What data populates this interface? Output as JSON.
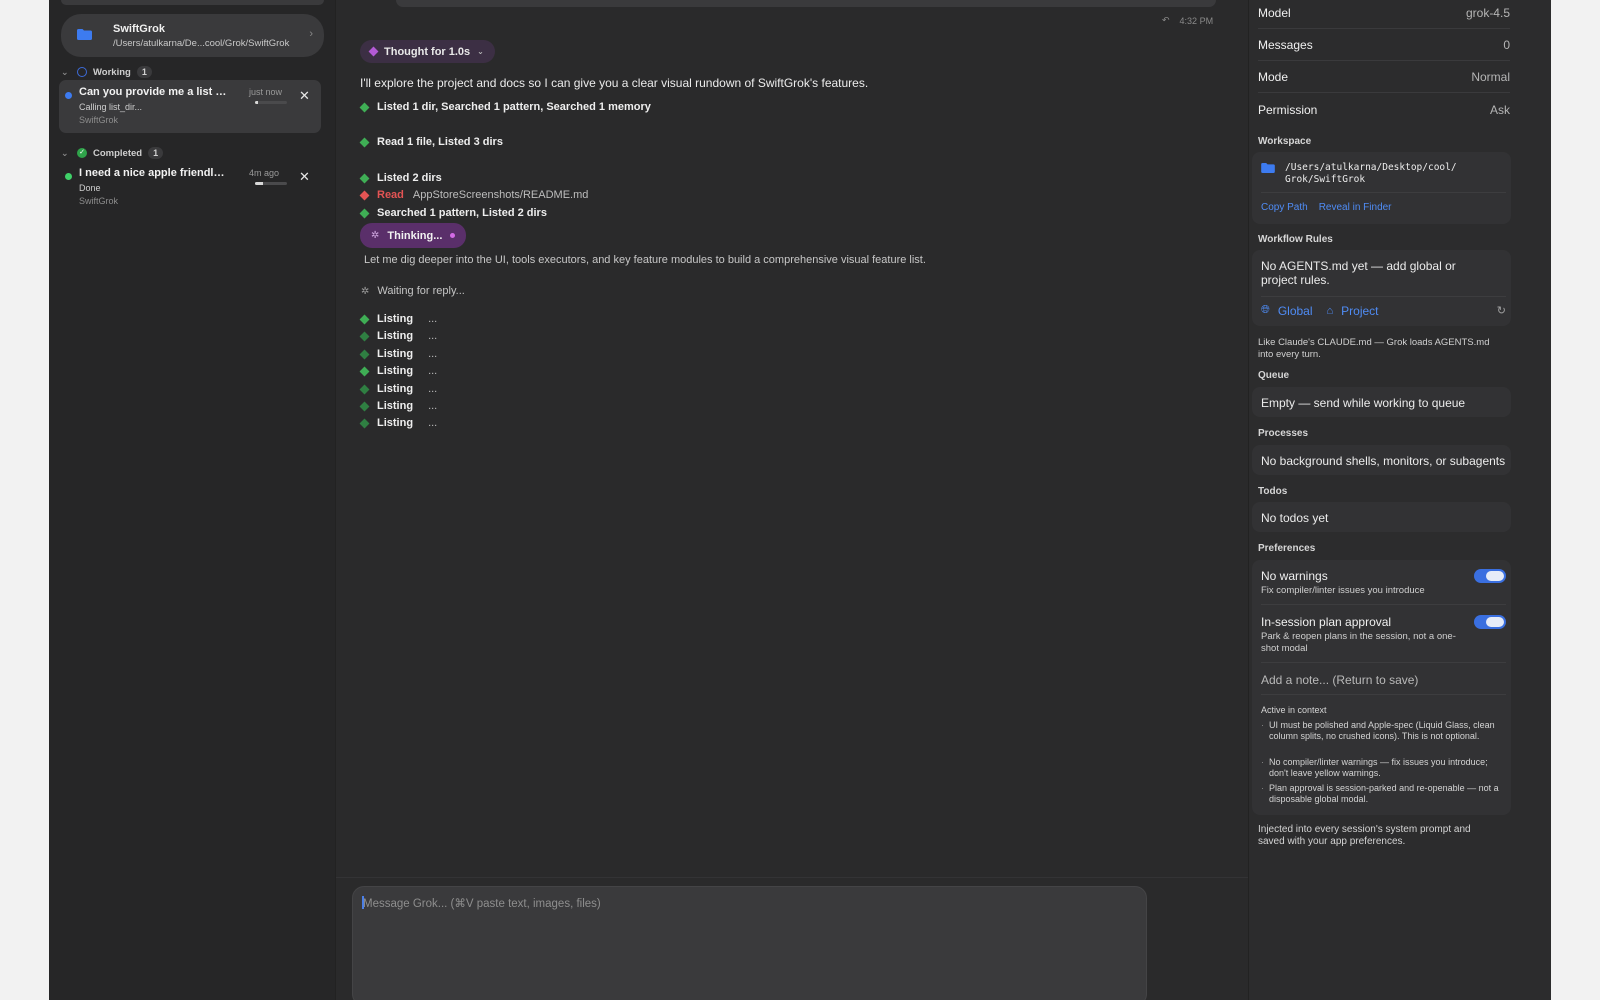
{
  "sidebar": {
    "project": {
      "name": "SwiftGrok",
      "path": "/Users/atulkarna/De...cool/Grok/SwiftGrok"
    },
    "sections": {
      "working": {
        "label": "Working",
        "count": "1"
      },
      "completed": {
        "label": "Completed",
        "count": "1"
      }
    },
    "tasks": [
      {
        "title": "Can you provide me a list vi...",
        "subtitle": "Calling list_dir...",
        "project": "SwiftGrok",
        "time": "just now",
        "status_color": "#3d7bf0",
        "progress": 0.1
      },
      {
        "title": "I need a nice apple friendly s...",
        "subtitle": "Done",
        "project": "SwiftGrok",
        "time": "4m ago",
        "status_color": "#3fd168",
        "progress": 0.25
      }
    ]
  },
  "main": {
    "timestamp": "4:32 PM",
    "thought_pill": "Thought for 1.0s",
    "intro": "I'll explore the project and docs so I can give you a clear visual rundown of SwiftGrok's features.",
    "steps": [
      {
        "text": "Listed 1 dir, Searched 1 pattern, Searched 1 memory"
      },
      {
        "text": "Read 1 file, Listed 3 dirs"
      },
      {
        "text": "Listed 2 dirs"
      },
      {
        "read_word": "Read",
        "read_path": "AppStoreScreenshots/README.md"
      },
      {
        "text": "Searched 1 pattern, Listed 2 dirs"
      }
    ],
    "thinking_pill": "Thinking...",
    "thinking_text": "Let me dig deeper into the UI, tools executors, and key feature modules to build a comprehensive visual feature list.",
    "waiting": "Waiting for reply...",
    "listing_label": "Listing",
    "listing_ellipsis": "...",
    "composer_placeholder": "Message Grok...  (⌘V paste text, images, files)"
  },
  "panel": {
    "info": [
      {
        "key": "Model",
        "value": "grok-4.5"
      },
      {
        "key": "Messages",
        "value": "0"
      },
      {
        "key": "Mode",
        "value": "Normal"
      },
      {
        "key": "Permission",
        "value": "Ask"
      }
    ],
    "workspace": {
      "heading": "Workspace",
      "path_line1": "/Users/atulkarna/Desktop/cool/",
      "path_line2": "Grok/SwiftGrok",
      "copy_path": "Copy Path",
      "reveal": "Reveal in Finder"
    },
    "workflow": {
      "heading": "Workflow Rules",
      "text": "No AGENTS.md yet — add global or project rules.",
      "global": "Global",
      "project": "Project",
      "note": "Like Claude's CLAUDE.md — Grok loads AGENTS.md into every turn."
    },
    "queue": {
      "heading": "Queue",
      "text": "Empty — send while working to queue"
    },
    "processes": {
      "heading": "Processes",
      "text": "No background shells, monitors, or subagents"
    },
    "todos": {
      "heading": "Todos",
      "text": "No todos yet"
    },
    "preferences": {
      "heading": "Preferences",
      "items": [
        {
          "title": "No warnings",
          "subtitle": "Fix compiler/linter issues you introduce",
          "on": true
        },
        {
          "title": "In-session plan approval",
          "subtitle": "Park & reopen plans in the session, not a one-shot modal",
          "on": true
        }
      ],
      "note_placeholder": "Add a note... (Return to save)",
      "active_heading": "Active in context",
      "bullets": [
        "UI must be polished and Apple-spec (Liquid Glass, clean column splits, no crushed icons). This is not optional.",
        "No compiler/linter warnings — fix issues you introduce; don't leave yellow warnings.",
        "Plan approval is session-parked and re-openable — not a disposable global modal."
      ],
      "footer": "Injected into every session's system prompt and saved with your app preferences."
    }
  },
  "colors": {
    "accent": "#4f8cf5",
    "green": "#3fae55",
    "red": "#e45454",
    "purple": "#b45ad6"
  }
}
